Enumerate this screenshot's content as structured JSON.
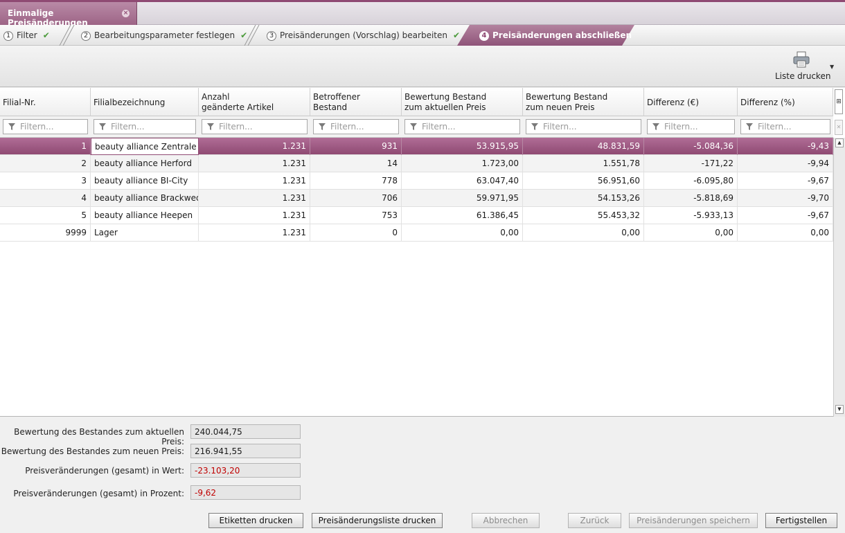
{
  "doc_tab": {
    "title": "Einmalige Preisänderungen"
  },
  "wizard": {
    "steps": [
      {
        "num": "1",
        "label": "Filter"
      },
      {
        "num": "2",
        "label": "Bearbeitungsparameter festlegen"
      },
      {
        "num": "3",
        "label": "Preisänderungen (Vorschlag) bearbeiten"
      },
      {
        "num": "4",
        "label": "Preisänderungen abschließen"
      }
    ]
  },
  "toolbar": {
    "print_list_label": "Liste drucken"
  },
  "grid": {
    "headers": [
      "Filial-Nr.",
      "Filialbezeichnung",
      "Anzahl\ngeänderte Artikel",
      "Betroffener\nBestand",
      "Bewertung Bestand\nzum aktuellen Preis",
      "Bewertung Bestand\nzum neuen Preis",
      "Differenz (€)",
      "Differenz (%)"
    ],
    "filter_placeholder": "Filtern...",
    "rows": [
      [
        "1",
        "beauty alliance Zentrale",
        "1.231",
        "931",
        "53.915,95",
        "48.831,59",
        "-5.084,36",
        "-9,43"
      ],
      [
        "2",
        "beauty alliance Herford",
        "1.231",
        "14",
        "1.723,00",
        "1.551,78",
        "-171,22",
        "-9,94"
      ],
      [
        "3",
        "beauty alliance BI-City",
        "1.231",
        "778",
        "63.047,40",
        "56.951,60",
        "-6.095,80",
        "-9,67"
      ],
      [
        "4",
        "beauty alliance Brackwede",
        "1.231",
        "706",
        "59.971,95",
        "54.153,26",
        "-5.818,69",
        "-9,70"
      ],
      [
        "5",
        "beauty alliance Heepen",
        "1.231",
        "753",
        "61.386,45",
        "55.453,32",
        "-5.933,13",
        "-9,67"
      ],
      [
        "9999",
        "Lager",
        "1.231",
        "0",
        "0,00",
        "0,00",
        "0,00",
        "0,00"
      ]
    ]
  },
  "summary": {
    "current_label": "Bewertung des Bestandes zum aktuellen Preis:",
    "current_value": "240.044,75",
    "new_label": "Bewertung des Bestandes zum neuen Preis:",
    "new_value": "216.941,55",
    "diff_value_label": "Preisveränderungen (gesamt) in Wert:",
    "diff_value": "-23.103,20",
    "diff_pct_label": "Preisveränderungen (gesamt) in Prozent:",
    "diff_pct": "-9,62"
  },
  "buttons": {
    "labels_print": "Etiketten drucken",
    "price_list_print": "Preisänderungsliste drucken",
    "cancel": "Abbrechen",
    "back": "Zurück",
    "save": "Preisänderungen speichern",
    "finish": "Fertigstellen"
  },
  "colors": {
    "accent": "#8f4a73",
    "negative": "#c00000",
    "check": "#4a9a3a"
  }
}
